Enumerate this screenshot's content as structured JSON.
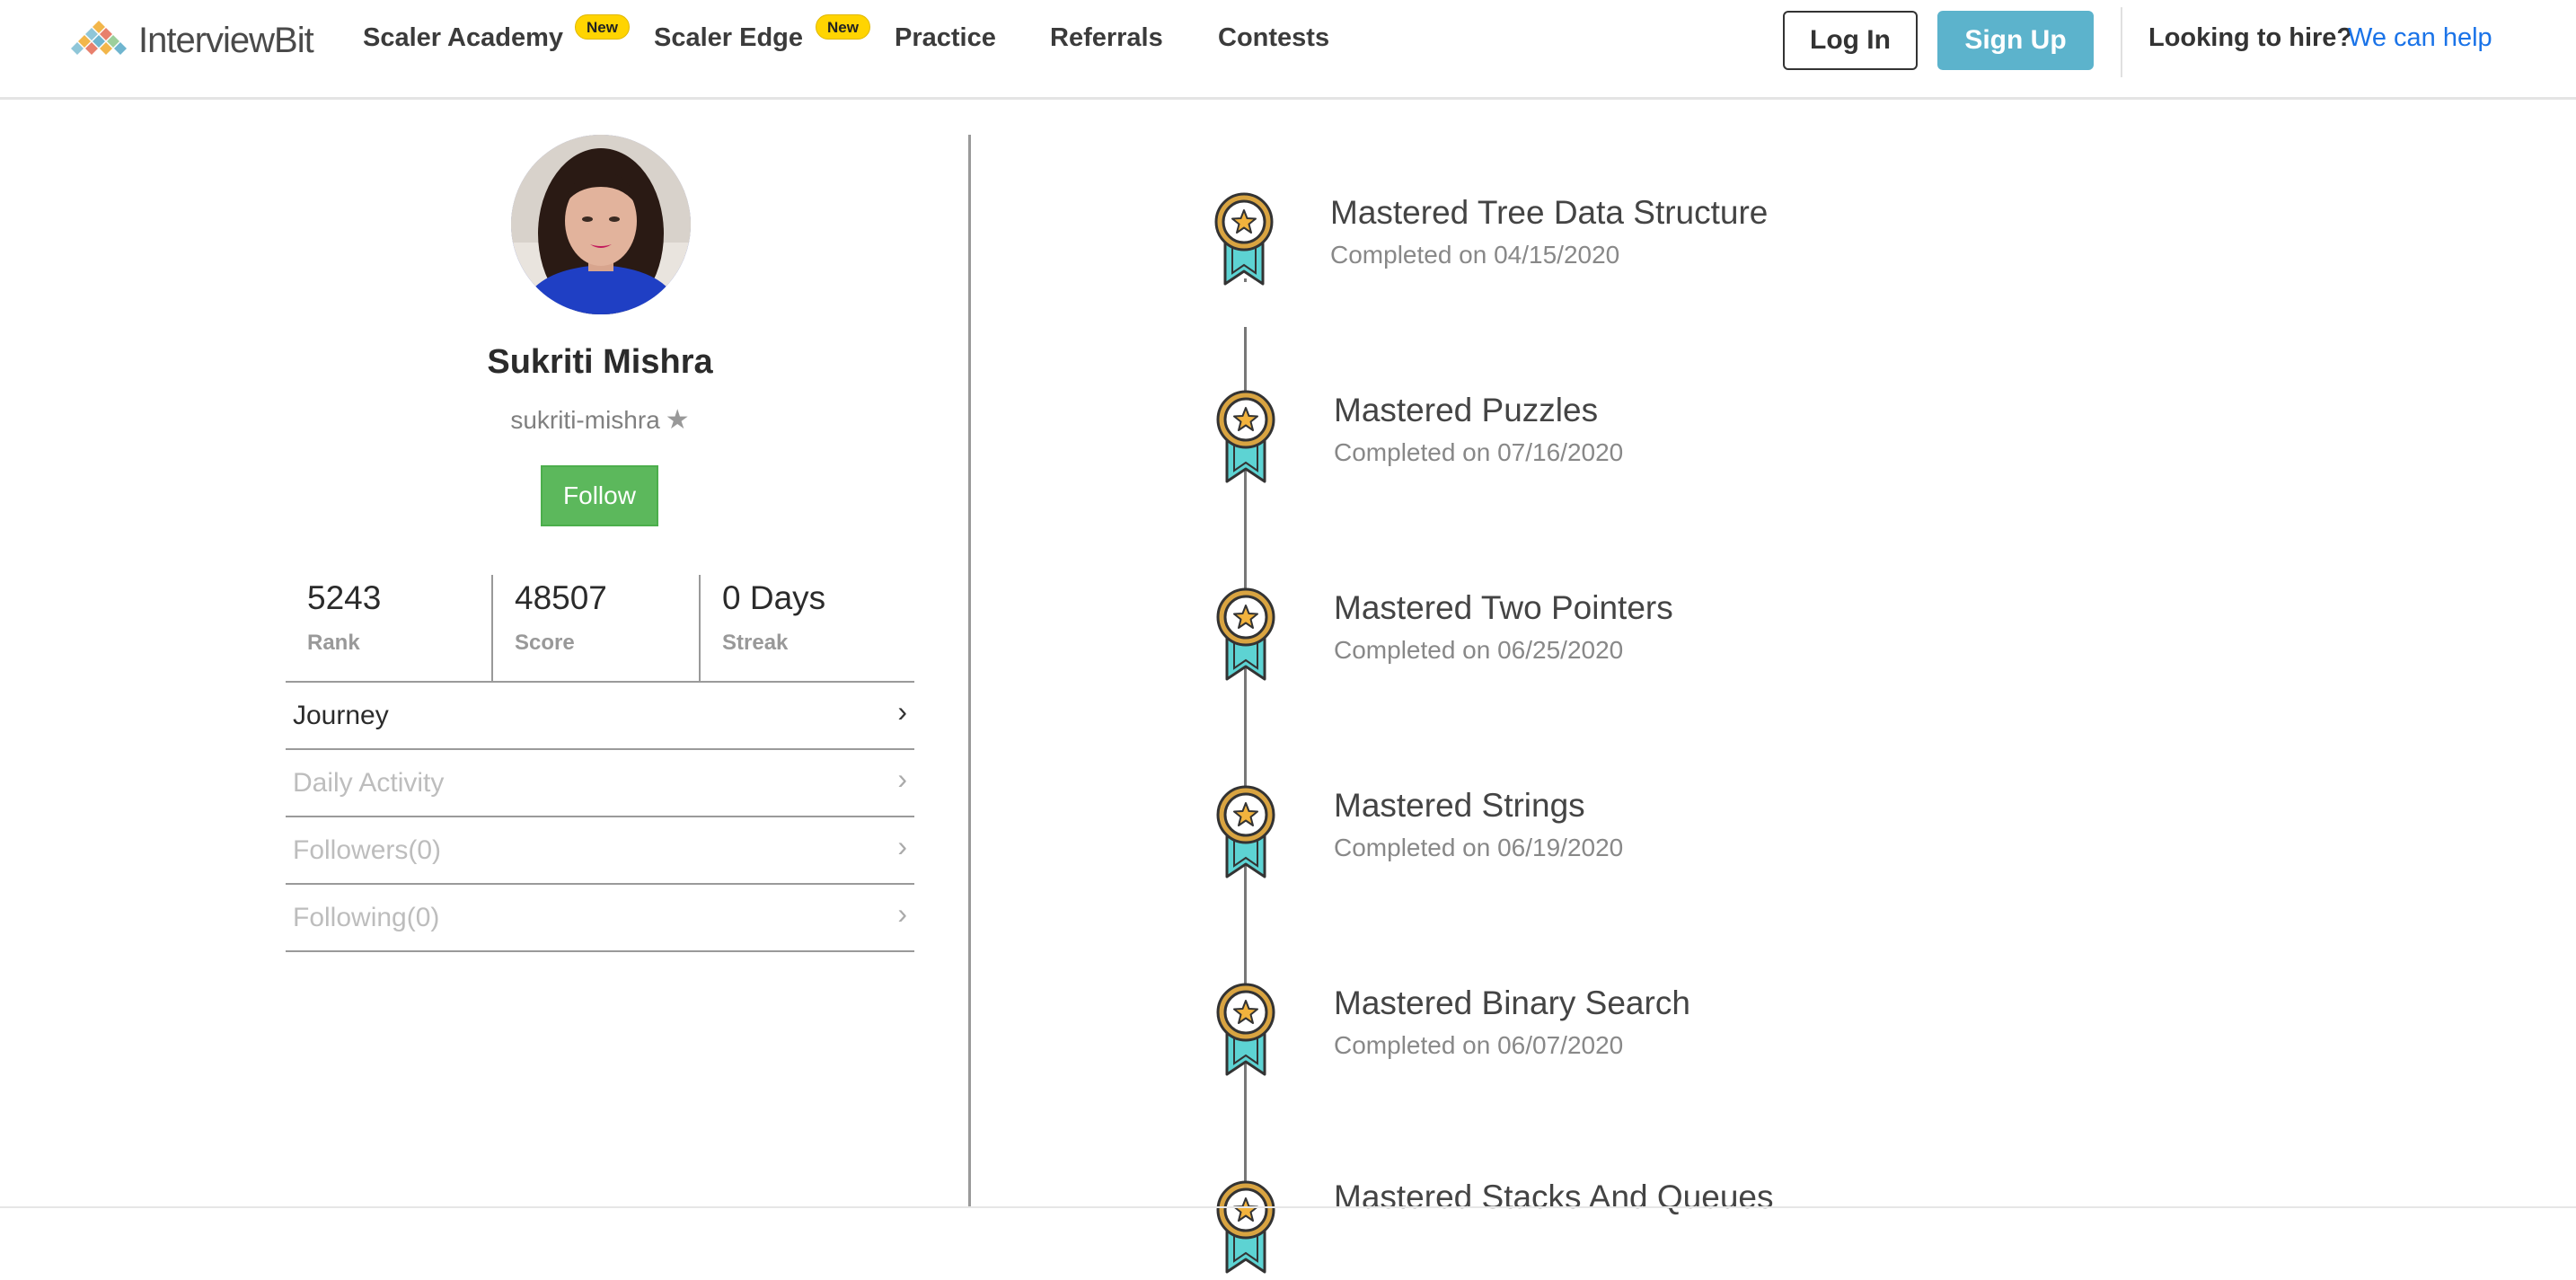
{
  "nav": {
    "logo_text": "InterviewBit",
    "items": [
      {
        "label": "Scaler Academy",
        "badge": "New"
      },
      {
        "label": "Scaler Edge",
        "badge": "New"
      },
      {
        "label": "Practice"
      },
      {
        "label": "Referrals"
      },
      {
        "label": "Contests"
      }
    ],
    "login_label": "Log In",
    "signup_label": "Sign Up",
    "hire_text": "Looking to hire?",
    "hire_link": "We can help"
  },
  "profile": {
    "name": "Sukriti Mishra",
    "username": "sukriti-mishra",
    "follow_label": "Follow",
    "stats": [
      {
        "value": "5243",
        "label": "Rank"
      },
      {
        "value": "48507",
        "label": "Score"
      },
      {
        "value": "0 Days",
        "label": "Streak"
      }
    ],
    "menu": [
      {
        "label": "Journey",
        "active": true
      },
      {
        "label": "Daily Activity",
        "active": false
      },
      {
        "label": "Followers(0)",
        "active": false
      },
      {
        "label": "Following(0)",
        "active": false
      }
    ]
  },
  "timeline": [
    {
      "title": "Mastered Tree Data Structure",
      "date": "Completed on 04/15/2020"
    },
    {
      "title": "Mastered Puzzles",
      "date": "Completed on 07/16/2020"
    },
    {
      "title": "Mastered Two Pointers",
      "date": "Completed on 06/25/2020"
    },
    {
      "title": "Mastered Strings",
      "date": "Completed on 06/19/2020"
    },
    {
      "title": "Mastered Binary Search",
      "date": "Completed on 06/07/2020"
    },
    {
      "title": "Mastered Stacks And Queues",
      "date": ""
    }
  ],
  "colors": {
    "signup": "#5cb3cc",
    "follow": "#5cb85c",
    "badge": "#ffd401",
    "link": "#1a73e8",
    "medal_ribbon": "#5dd3d3",
    "medal_ring": "#d9a441"
  },
  "icons": [
    "logo-mark-icon",
    "star-icon",
    "chevron-right-icon",
    "medal-icon"
  ]
}
